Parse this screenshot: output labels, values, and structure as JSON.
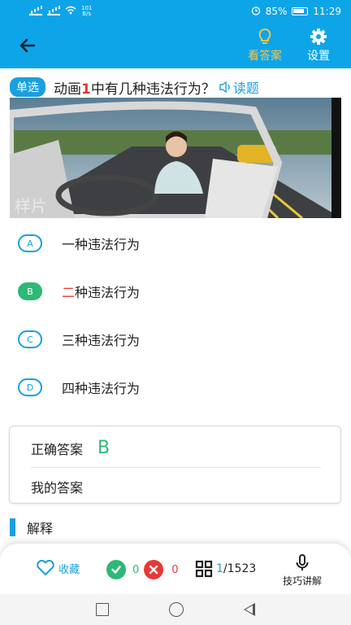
{
  "status_bar": {
    "network_speed": "101",
    "network_unit": "B/s",
    "battery": "85%",
    "time": "11:29"
  },
  "header": {
    "answer_label": "看答案",
    "settings_label": "设置"
  },
  "question": {
    "type_badge": "单选",
    "text_before": "动画",
    "text_number": "1",
    "text_after": "中有几种违法行为？",
    "read_label": "读题"
  },
  "video": {
    "watermark": "样片"
  },
  "options": [
    {
      "letter": "A",
      "text_highlight": "",
      "text": "一种违法行为"
    },
    {
      "letter": "B",
      "text_highlight": "二",
      "text": "种违法行为"
    },
    {
      "letter": "C",
      "text_highlight": "",
      "text": "三种违法行为"
    },
    {
      "letter": "D",
      "text_highlight": "",
      "text": "四种违法行为"
    }
  ],
  "answer_card": {
    "correct_label": "正确答案",
    "correct_value": "B",
    "my_label": "我的答案"
  },
  "explanation": {
    "title": "解释"
  },
  "bottom_bar": {
    "favorite_label": "收藏",
    "correct_count": "0",
    "wrong_count": "0",
    "progress_current": "1",
    "progress_total": "/1523",
    "tips_label": "技巧讲解"
  },
  "colors": {
    "primary": "#0ea4e8",
    "accent_blue": "#1a9fe0",
    "correct_green": "#2db976",
    "wrong_red": "#e53935",
    "answer_yellow": "#f7c548"
  }
}
